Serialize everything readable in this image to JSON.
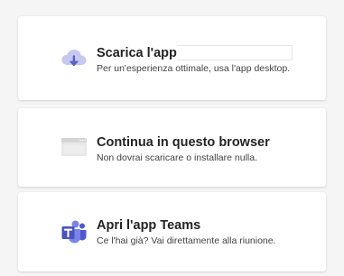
{
  "options": [
    {
      "title": "Scarica l'app",
      "subtitle": "Per un'esperienza ottimale, usa l'app desktop.",
      "icon": "cloud-download-icon"
    },
    {
      "title": "Continua in questo browser",
      "subtitle": "Non dovrai scaricare o installare nulla.",
      "icon": "browser-window-icon"
    },
    {
      "title": "Apri l'app Teams",
      "subtitle": "Ce l'hai già? Vai direttamente alla riunione.",
      "icon": "teams-logo-icon"
    }
  ],
  "colors": {
    "accent": "#5b5fc7",
    "accent_light": "#7b83eb",
    "accent_dark": "#4b53bc",
    "icon_gray": "#d6d6d6",
    "background": "#f5f5f5"
  }
}
